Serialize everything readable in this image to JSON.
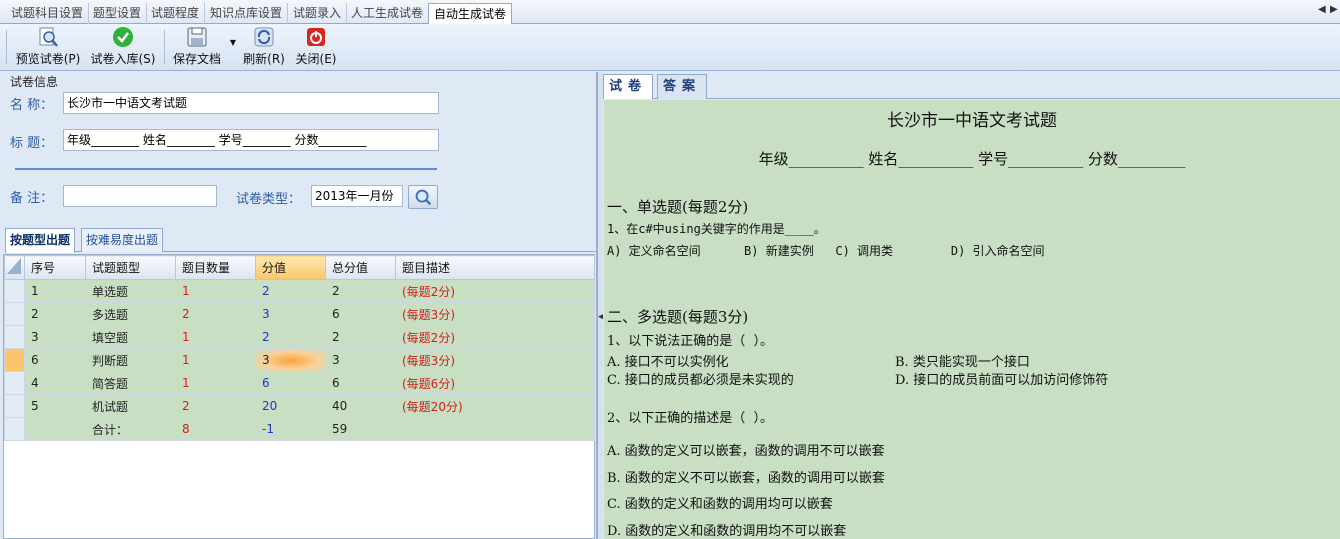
{
  "top_tabs": [
    "试题科目设置",
    "题型设置",
    "试题程度",
    "知识点库设置",
    "试题录入",
    "人工生成试卷",
    "自动生成试卷"
  ],
  "toolbar": {
    "preview": "预览试卷(P)",
    "store": "试卷入库(S)",
    "save": "保存文档",
    "refresh": "刷新(R)",
    "close": "关闭(E)"
  },
  "paper_info": {
    "group_title": "试卷信息",
    "name_label": "名 称：",
    "name_value": "长沙市一中语文考试题",
    "heading_label": "标 题：",
    "heading_value": "年级________ 姓名________ 学号________ 分数________",
    "note_label": "备 注：",
    "note_value": "",
    "type_label": "试卷类型：",
    "type_value": "2013年一月份"
  },
  "sub_tabs": [
    "按题型出题",
    "按难易度出题"
  ],
  "grid": {
    "columns": [
      "序号",
      "试题题型",
      "题目数量",
      "分值",
      "总分值",
      "题目描述"
    ],
    "rows": [
      [
        "1",
        "单选题",
        "1",
        "2",
        "2",
        "(每题2分)"
      ],
      [
        "2",
        "多选题",
        "2",
        "3",
        "6",
        "(每题3分)"
      ],
      [
        "3",
        "填空题",
        "1",
        "2",
        "2",
        "(每题2分)"
      ],
      [
        "6",
        "判断题",
        "1",
        "3",
        "3",
        "(每题3分)"
      ],
      [
        "4",
        "简答题",
        "1",
        "6",
        "6",
        "(每题6分)"
      ],
      [
        "5",
        "机试题",
        "2",
        "20",
        "40",
        "(每题20分)"
      ],
      [
        "",
        "合计：",
        "8",
        "-1",
        "59",
        ""
      ]
    ]
  },
  "right_tabs": [
    "试卷",
    "答案"
  ],
  "doc": {
    "title": "长沙市一中语文考试题",
    "header": "年级__________ 姓名__________ 学号__________ 分数_________",
    "sec1": "一、单选题(每题2分)",
    "q1": "1、在c#中using关键字的作用是____。",
    "q1_opts": "A) 定义命名空间      B) 新建实例   C) 调用类        D) 引入命名空间",
    "sec2": "二、多选题(每题3分)",
    "q2": "1、以下说法正确的是（  ）。",
    "q2_a": "A. 接口不可以实例化",
    "q2_b": "B. 类只能实现一个接口",
    "q2_c": "C. 接口的成员都必须是未实现的",
    "q2_d": "D. 接口的成员前面可以加访问修饰符",
    "q3": "2、以下正确的描述是（  ）。",
    "q3_a": "A. 函数的定义可以嵌套，函数的调用不可以嵌套",
    "q3_b": "B. 函数的定义不可以嵌套，函数的调用可以嵌套",
    "q3_c": "C. 函数的定义和函数的调用均可以嵌套",
    "q3_d": "D. 函数的定义和函数的调用均不可以嵌套"
  },
  "colors": {
    "grid_row": "#c8dfc3",
    "selected_cell": "#f7a33b",
    "label_blue": "#2e5ea8"
  }
}
